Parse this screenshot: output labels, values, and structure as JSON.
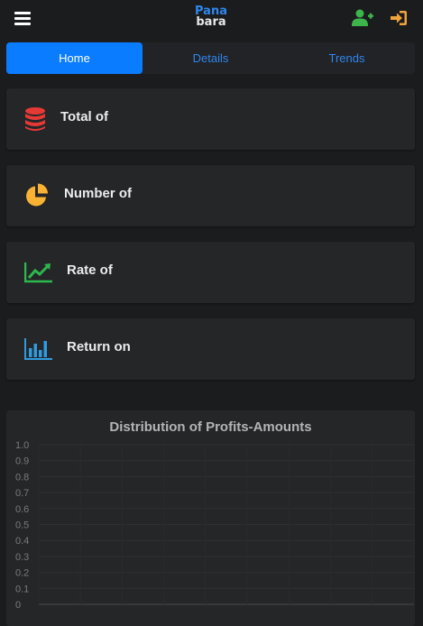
{
  "header": {
    "menu_icon": "hamburger-menu-icon",
    "logo_line1": "Pana",
    "logo_line2": "bara",
    "add_user_icon": "user-plus-icon",
    "add_user_color": "#3cb64a",
    "signin_icon": "sign-in-icon",
    "signin_color": "#f2a23a"
  },
  "tabs": [
    {
      "label": "Home",
      "active": true
    },
    {
      "label": "Details",
      "active": false
    },
    {
      "label": "Trends",
      "active": false
    }
  ],
  "cards": [
    {
      "title": "Total of",
      "icon": "database-icon",
      "color": "#e53935"
    },
    {
      "title": "Number of",
      "icon": "pie-chart-icon",
      "color": "#f9b233"
    },
    {
      "title": "Rate of",
      "icon": "line-chart-icon",
      "color": "#2db84d"
    },
    {
      "title": "Return on",
      "icon": "bar-chart-icon",
      "color": "#2f9be0"
    }
  ],
  "colors": {
    "accent": "#0a7cff",
    "background": "#1b1c1e",
    "card": "#252628"
  },
  "chart_data": {
    "type": "bar",
    "title": "Distribution of Profits-Amounts",
    "categories": [],
    "series": [],
    "xlabel": "",
    "ylabel": "",
    "ylim": [
      0,
      1
    ],
    "yticks": [
      "1.0",
      "0.9",
      "0.8",
      "0.7",
      "0.6",
      "0.5",
      "0.4",
      "0.3",
      "0.2",
      "0.1",
      "0"
    ],
    "grid": true
  }
}
